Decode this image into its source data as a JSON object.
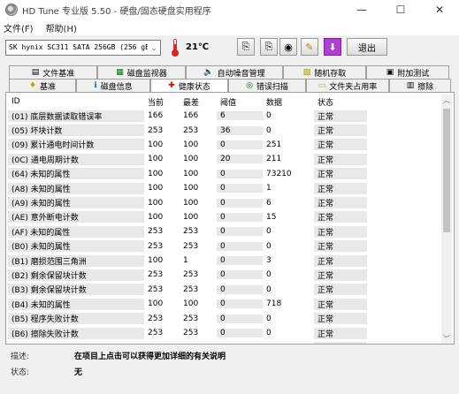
{
  "window": {
    "title": "HD Tune 专业版 5.50 - 硬盘/固态硬盘实用程序",
    "min_glyph": "—",
    "max_glyph": "☐",
    "close_glyph": "✕"
  },
  "menu": {
    "items": [
      "文件(F)",
      "帮助(H)"
    ]
  },
  "toolbar": {
    "drive": "SK hynix SC311 SATA 256GB (256 gB)",
    "drive_arrow": "⌵",
    "temperature": "21℃",
    "exit_label": "退出",
    "buttons": [
      {
        "icon": "copy-info-icon",
        "glyph": "⎘"
      },
      {
        "icon": "copy-text-icon",
        "glyph": "⎘"
      },
      {
        "icon": "camera-icon",
        "glyph": "◉"
      },
      {
        "icon": "options-icon",
        "glyph": "✎"
      },
      {
        "icon": "save-download-icon",
        "glyph": "⬇",
        "color": "#a020c0"
      }
    ]
  },
  "tabs": {
    "row1": [
      {
        "label": "文件基准",
        "icon": "file-benchmark-icon",
        "glyph": "▤"
      },
      {
        "label": "磁盘监视器",
        "icon": "disk-monitor-icon",
        "glyph": "▦"
      },
      {
        "label": "自动噪音管理",
        "icon": "speaker-icon",
        "glyph": "🔈"
      },
      {
        "label": "随机存取",
        "icon": "random-access-icon",
        "glyph": "▧"
      },
      {
        "label": "附加测试",
        "icon": "extra-tests-icon",
        "glyph": "▣"
      }
    ],
    "row2": [
      {
        "label": "基准",
        "icon": "benchmark-icon",
        "glyph": "♦"
      },
      {
        "label": "磁盘信息",
        "icon": "disk-info-icon",
        "glyph": "ℹ"
      },
      {
        "label": "健康状态",
        "icon": "health-icon",
        "glyph": "✚",
        "active": true
      },
      {
        "label": "错误扫描",
        "icon": "error-scan-icon",
        "glyph": "◎"
      },
      {
        "label": "文件夹占用率",
        "icon": "folder-usage-icon",
        "glyph": "▭"
      },
      {
        "label": "擦除",
        "icon": "erase-icon",
        "glyph": "▥"
      }
    ]
  },
  "table": {
    "headers": [
      "ID",
      "当前",
      "最差",
      "阈值",
      "数据",
      "状态"
    ],
    "rows": [
      [
        "(01) 底层数据读取错误率",
        "166",
        "166",
        "6",
        "0",
        "正常"
      ],
      [
        "(05) 坏块计数",
        "253",
        "253",
        "36",
        "0",
        "正常"
      ],
      [
        "(09) 累计通电时间计数",
        "100",
        "100",
        "0",
        "251",
        "正常"
      ],
      [
        "(0C) 通电周期计数",
        "100",
        "100",
        "20",
        "211",
        "正常"
      ],
      [
        "(64) 未知的属性",
        "100",
        "100",
        "0",
        "73210",
        "正常"
      ],
      [
        "(A8) 未知的属性",
        "100",
        "100",
        "0",
        "1",
        "正常"
      ],
      [
        "(A9) 未知的属性",
        "100",
        "100",
        "0",
        "6",
        "正常"
      ],
      [
        "(AE) 意外断电计数",
        "100",
        "100",
        "0",
        "15",
        "正常"
      ],
      [
        "(AF) 未知的属性",
        "253",
        "253",
        "0",
        "0",
        "正常"
      ],
      [
        "(B0) 未知的属性",
        "253",
        "253",
        "0",
        "0",
        "正常"
      ],
      [
        "(B1) 磨损范围三角洲",
        "100",
        "1",
        "0",
        "3",
        "正常"
      ],
      [
        "(B2) 剩余保留块计数",
        "253",
        "253",
        "0",
        "0",
        "正常"
      ],
      [
        "(B3) 剩余保留块计数",
        "253",
        "253",
        "0",
        "0",
        "正常"
      ],
      [
        "(B4) 未知的属性",
        "100",
        "100",
        "0",
        "718",
        "正常"
      ],
      [
        "(B5) 程序失败计数",
        "253",
        "253",
        "0",
        "0",
        "正常"
      ],
      [
        "(B6) 擦除失败计数",
        "253",
        "253",
        "0",
        "0",
        "正常"
      ],
      [
        "",
        "",
        "",
        "",
        "",
        "正常"
      ]
    ]
  },
  "scrollbar": {
    "up_glyph": "︿",
    "down_glyph": "﹀"
  },
  "footer": {
    "description_label": "描述:",
    "description_value": "在项目上点击可以获得更加详细的有关说明",
    "status_label": "状态:",
    "status_value": "无"
  }
}
